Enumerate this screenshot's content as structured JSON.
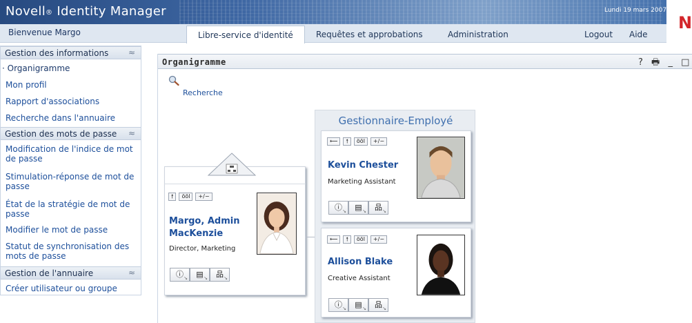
{
  "header": {
    "app_name": "Novell",
    "app_mark": "®",
    "app_suffix": "Identity Manager",
    "date": "Lundi 19 mars 2007",
    "logo_letter": "N"
  },
  "nav": {
    "welcome": "Bienvenue Margo",
    "tabs": [
      {
        "label": "Libre-service d'identité",
        "active": true
      },
      {
        "label": "Requêtes et approbations",
        "active": false
      },
      {
        "label": "Administration",
        "active": false
      }
    ],
    "logout": "Logout",
    "help": "Aide"
  },
  "sidebar": {
    "sections": [
      {
        "title": "Gestion des informations",
        "items": [
          "Organigramme",
          "Mon profil",
          "Rapport d'associations",
          "Recherche dans l'annuaire"
        ]
      },
      {
        "title": "Gestion des mots de passe",
        "items": [
          "Modification de l'indice de mot de passe",
          "Stimulation-réponse de mot de passe",
          "État de la stratégie de mot de passe",
          "Modifier le mot de passe",
          "Statut de synchronisation des mots de passe"
        ]
      },
      {
        "title": "Gestion de l'annuaire",
        "items": [
          "Créer utilisateur ou groupe"
        ]
      }
    ],
    "collapse_glyph": "≈"
  },
  "panel": {
    "title": "Organigramme",
    "icons": {
      "help": "?",
      "print": "🖶",
      "minimize": "_",
      "maximize": "□"
    },
    "search_label": "Recherche"
  },
  "orgchart": {
    "manager": {
      "name_line1": "Margo, Admin",
      "name_line2": "MacKenzie",
      "title": "Director, Marketing",
      "buttons": [
        "🠕",
        "ööl",
        "+/−"
      ]
    },
    "group_title": "Gestionnaire-Employé",
    "employees": [
      {
        "name": "Kevin Chester",
        "title": "Marketing Assistant",
        "buttons": [
          "⟵",
          "🠕",
          "ööl",
          "+/−"
        ]
      },
      {
        "name": "Allison Blake",
        "title": "Creative Assistant",
        "buttons": [
          "⟵",
          "🠕",
          "ööl",
          "+/−"
        ]
      }
    ],
    "action_icons": [
      "info-icon",
      "card-icon",
      "org-icon"
    ]
  },
  "colors": {
    "brand_red": "#d3262b",
    "link_blue": "#1d4f9b",
    "header_blue": "#274a80"
  }
}
